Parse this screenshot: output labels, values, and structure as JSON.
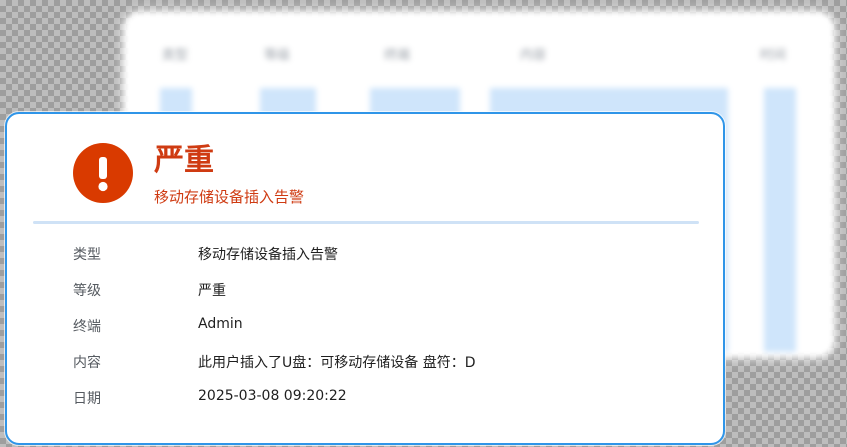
{
  "background_table": {
    "columns": [
      {
        "label": "类型"
      },
      {
        "label": "等级"
      },
      {
        "label": "终端"
      },
      {
        "label": "内容"
      },
      {
        "label": "时间"
      }
    ]
  },
  "alert": {
    "icon": "exclamation-icon",
    "icon_glyph": "!",
    "title": "严重",
    "subtitle": "移动存储设备插入告警",
    "accent_color": "#d93a00",
    "border_color": "#2f95e8",
    "details": [
      {
        "label": "类型",
        "value": "移动存储设备插入告警"
      },
      {
        "label": "等级",
        "value": "严重"
      },
      {
        "label": "终端",
        "value": "Admin"
      },
      {
        "label": "内容",
        "value": "此用户插入了U盘：可移动存储设备  盘符：D"
      },
      {
        "label": "日期",
        "value": "2025-03-08 09:20:22"
      }
    ]
  }
}
